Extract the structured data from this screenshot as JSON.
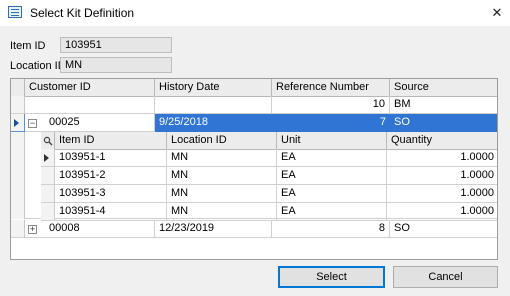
{
  "window": {
    "title": "Select Kit Definition",
    "close_glyph": "✕"
  },
  "form": {
    "item_id_label": "Item ID",
    "item_id_value": "103951",
    "location_id_label": "Location ID",
    "location_id_value": "MN"
  },
  "grid": {
    "columns": [
      "Customer ID",
      "History Date",
      "Reference Number",
      "Source"
    ],
    "rows": [
      {
        "expand": "+",
        "customer_id": "",
        "history_date": "",
        "reference_number": "10",
        "source": "BM"
      },
      {
        "expand": "−",
        "customer_id": "00025",
        "history_date": "9/25/2018",
        "reference_number": "7",
        "source": "SO"
      },
      {
        "expand": "+",
        "customer_id": "00008",
        "history_date": "12/23/2019",
        "reference_number": "8",
        "source": "SO"
      }
    ],
    "child": {
      "columns": [
        "Item ID",
        "Location ID",
        "Unit",
        "Quantity"
      ],
      "rows": [
        {
          "item_id": "103951-1",
          "location_id": "MN",
          "unit": "EA",
          "quantity": "1.0000"
        },
        {
          "item_id": "103951-2",
          "location_id": "MN",
          "unit": "EA",
          "quantity": "1.0000"
        },
        {
          "item_id": "103951-3",
          "location_id": "MN",
          "unit": "EA",
          "quantity": "1.0000"
        },
        {
          "item_id": "103951-4",
          "location_id": "MN",
          "unit": "EA",
          "quantity": "1.0000"
        }
      ]
    }
  },
  "buttons": {
    "select": "Select",
    "cancel": "Cancel"
  },
  "colors": {
    "selection": "#3175d4",
    "accent": "#0078d7"
  }
}
